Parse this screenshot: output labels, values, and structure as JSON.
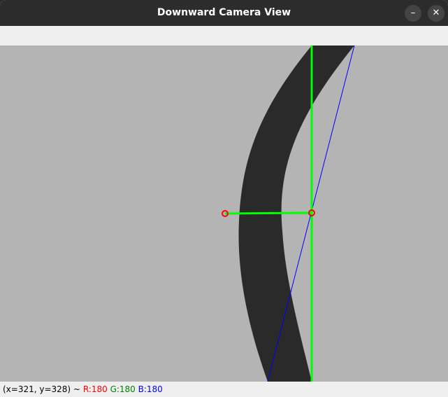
{
  "window": {
    "title": "Downward Camera View",
    "minimize_glyph": "–",
    "close_glyph": "✕"
  },
  "statusbar": {
    "coords": "(x=321, y=328) ~",
    "r_text": "R:180",
    "g_text": "G:180",
    "b_text": "B:180"
  },
  "colors": {
    "background": "#b4b4b4",
    "path": "#2a2a2a",
    "green": "#00ff00",
    "red": "#ff0000",
    "blue": "#0000ff"
  },
  "icons": [
    "minimize-icon",
    "close-icon"
  ]
}
